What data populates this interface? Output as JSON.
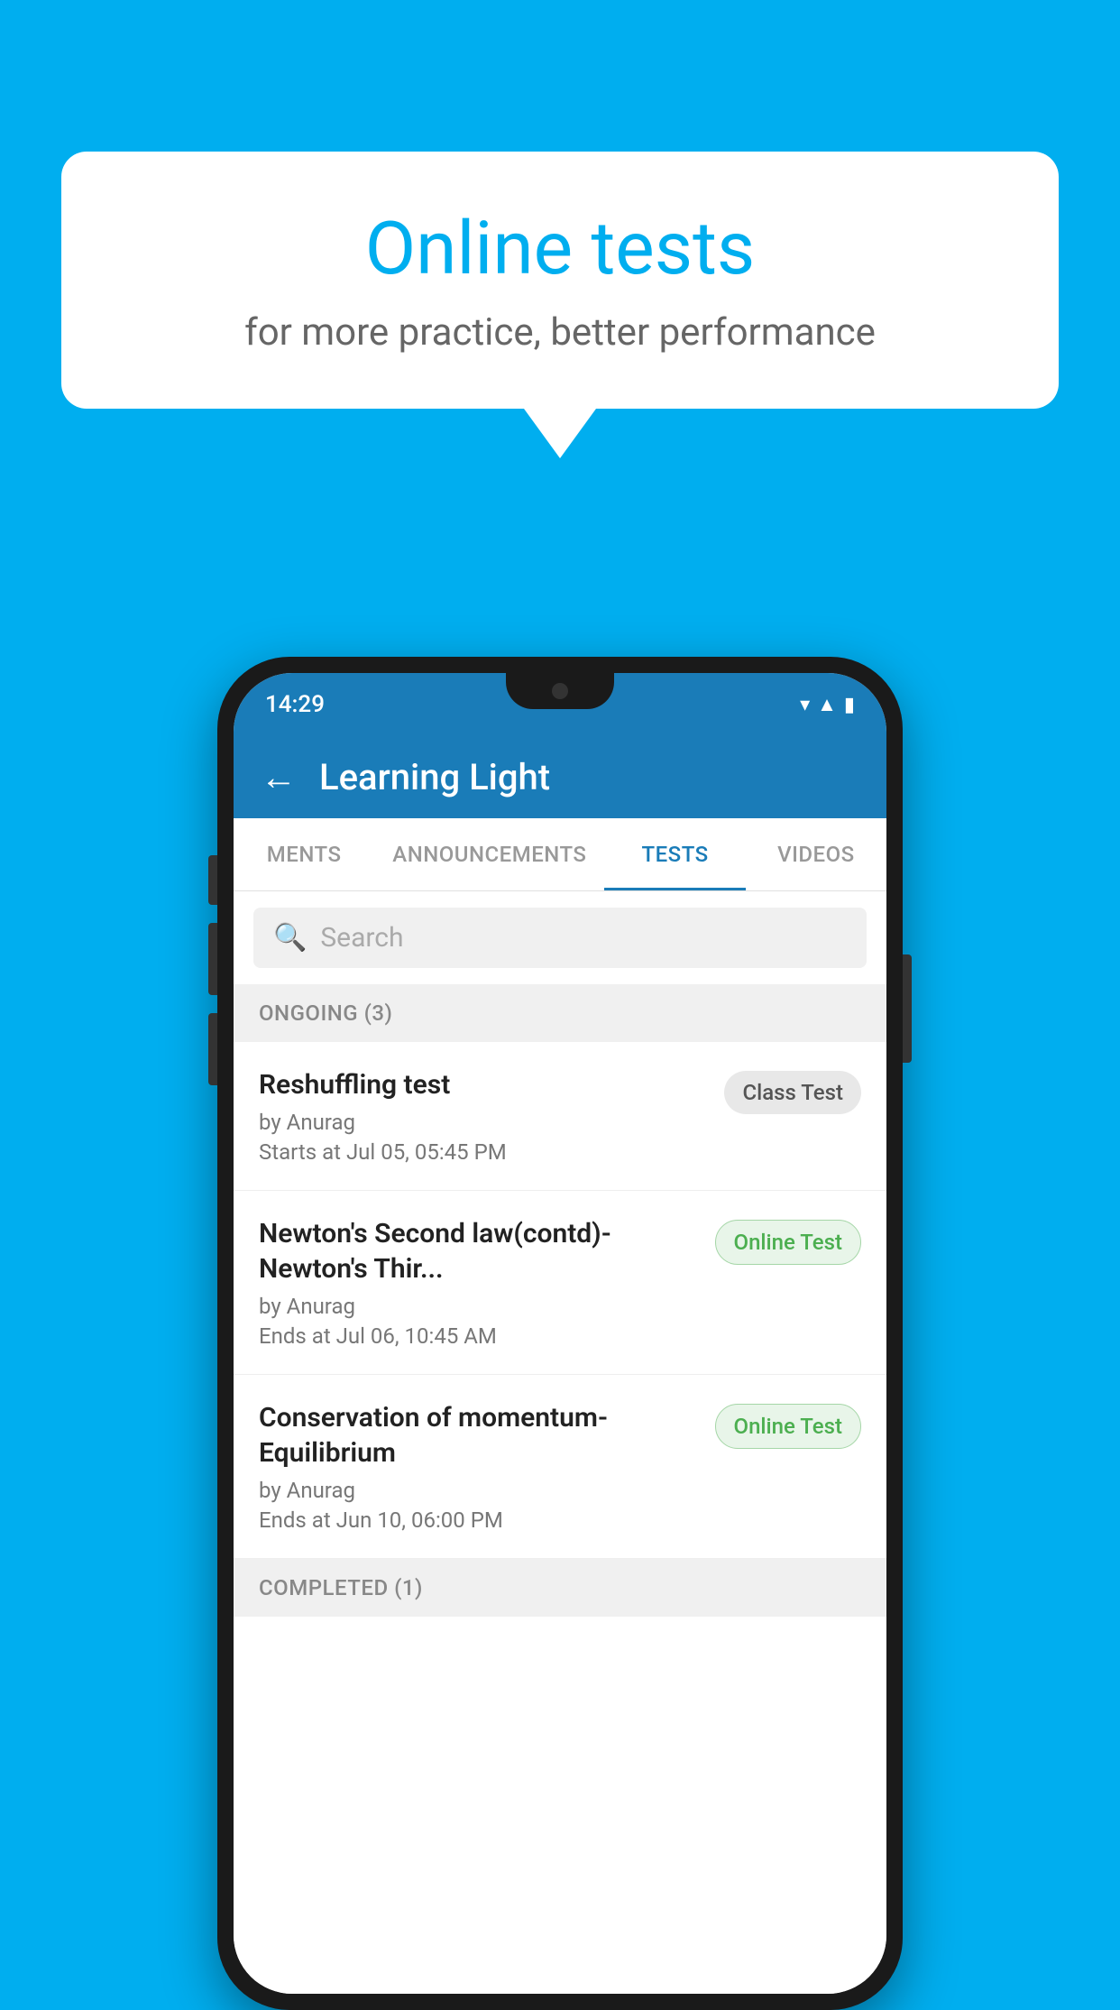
{
  "background_color": "#00AEEF",
  "speech_bubble": {
    "title": "Online tests",
    "subtitle": "for more practice, better performance"
  },
  "phone": {
    "status_bar": {
      "time": "14:29",
      "icons": [
        "wifi",
        "signal",
        "battery"
      ]
    },
    "header": {
      "title": "Learning Light",
      "back_label": "←"
    },
    "tabs": [
      {
        "label": "MENTS",
        "active": false
      },
      {
        "label": "ANNOUNCEMENTS",
        "active": false
      },
      {
        "label": "TESTS",
        "active": true
      },
      {
        "label": "VIDEOS",
        "active": false
      }
    ],
    "search": {
      "placeholder": "Search"
    },
    "ongoing_section": {
      "label": "ONGOING (3)",
      "tests": [
        {
          "name": "Reshuffling test",
          "author": "by Anurag",
          "time_label": "Starts at",
          "time": "Jul 05, 05:45 PM",
          "badge": "Class Test",
          "badge_type": "class"
        },
        {
          "name": "Newton's Second law(contd)-Newton's Thir...",
          "author": "by Anurag",
          "time_label": "Ends at",
          "time": "Jul 06, 10:45 AM",
          "badge": "Online Test",
          "badge_type": "online"
        },
        {
          "name": "Conservation of momentum-Equilibrium",
          "author": "by Anurag",
          "time_label": "Ends at",
          "time": "Jun 10, 06:00 PM",
          "badge": "Online Test",
          "badge_type": "online"
        }
      ]
    },
    "completed_section": {
      "label": "COMPLETED (1)"
    }
  }
}
